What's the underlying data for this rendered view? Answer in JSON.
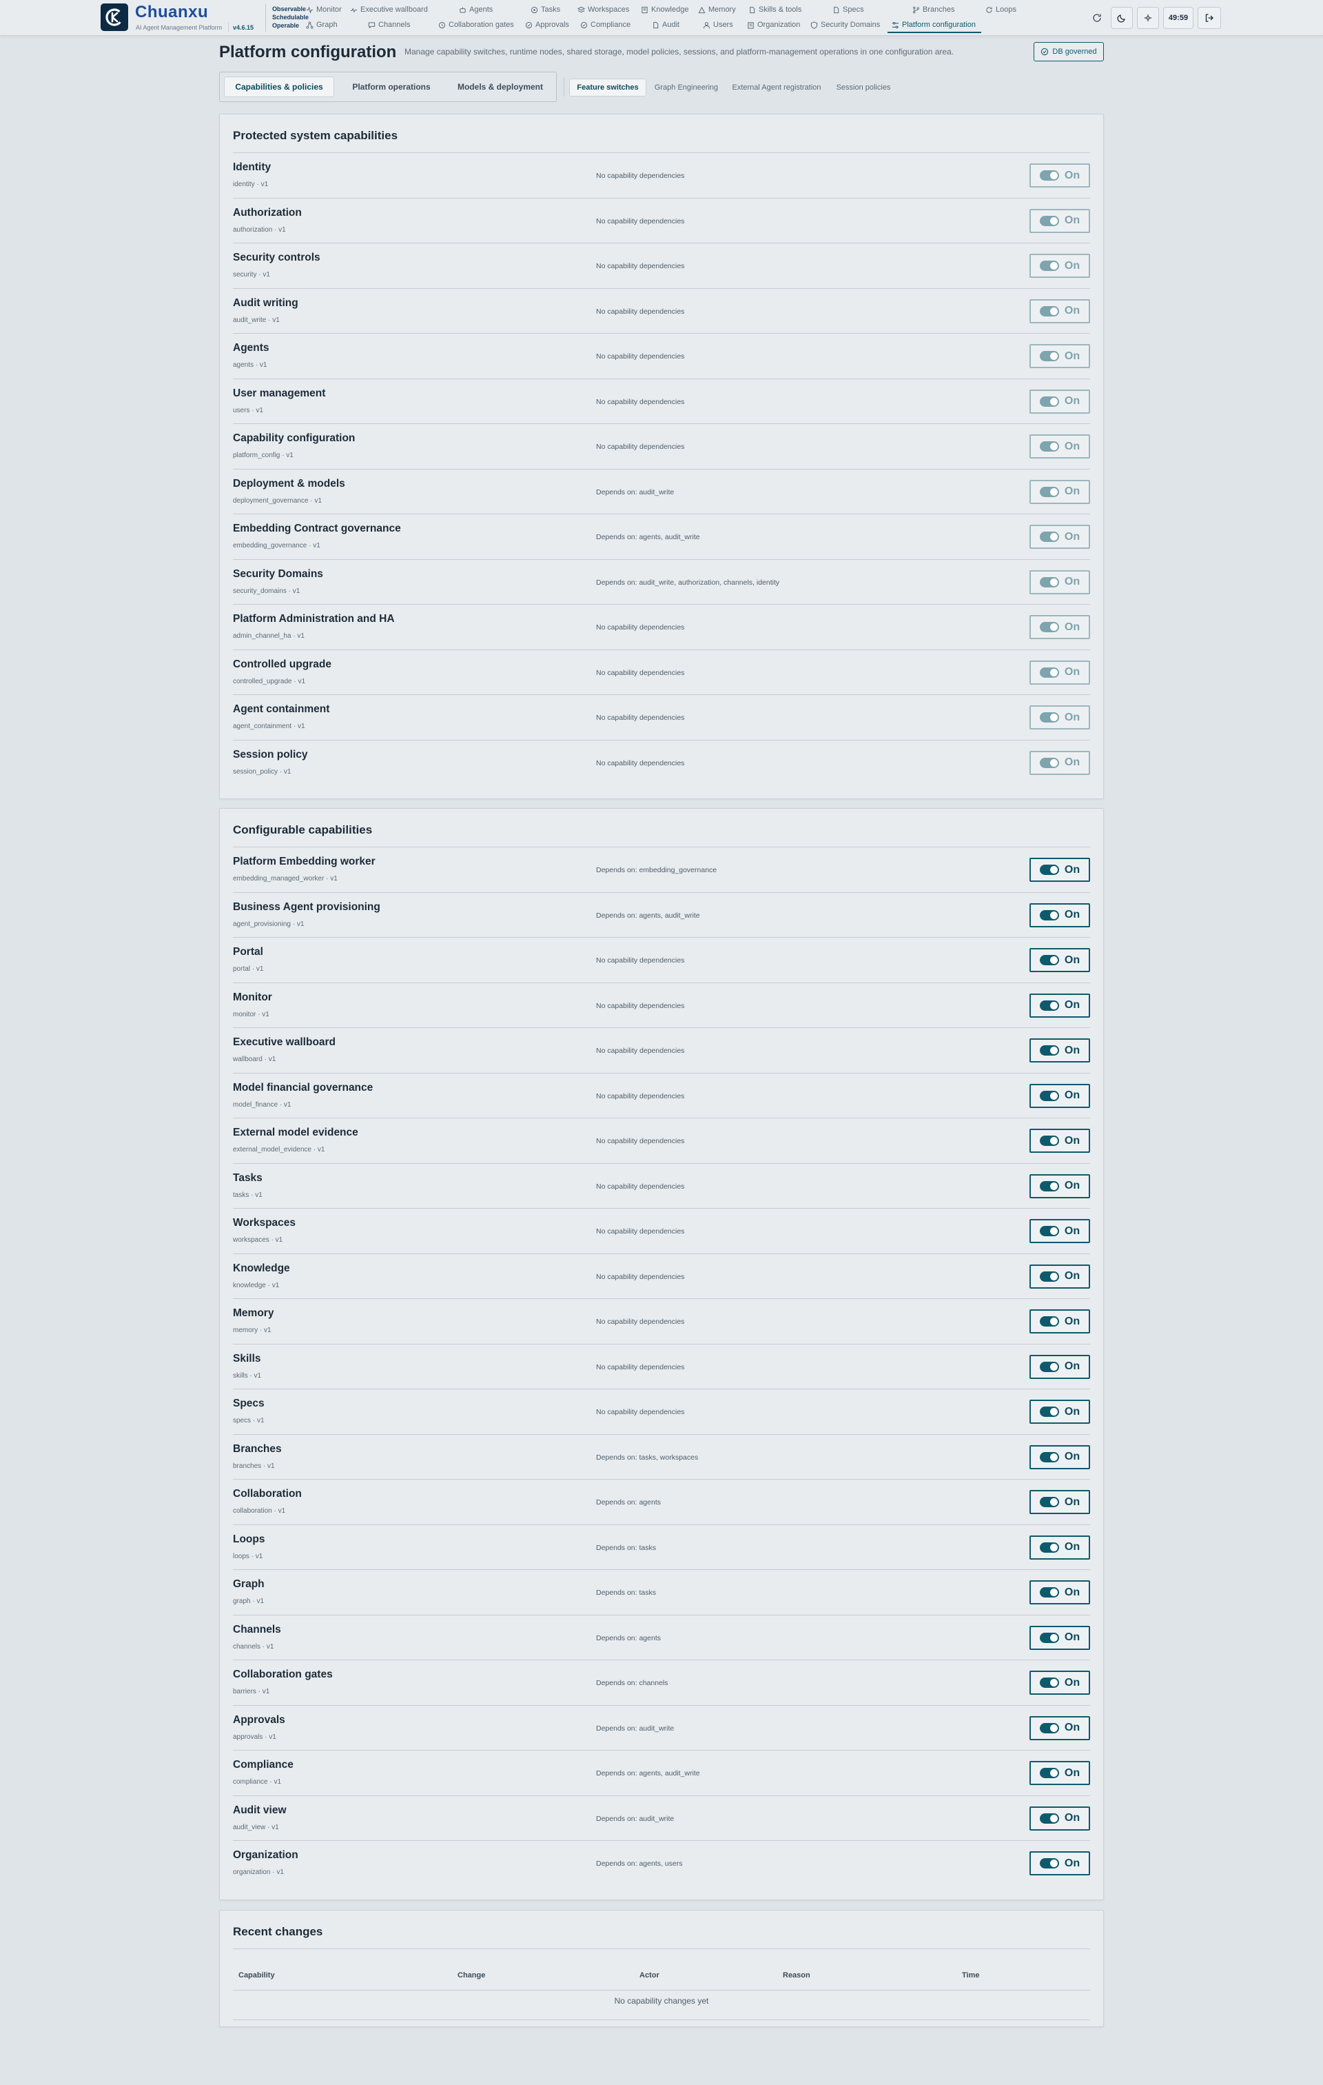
{
  "app": {
    "name": "Chuanxu",
    "subtitle": "AI Agent Management Platform",
    "version": "v4.6.15",
    "tagline": [
      "Observable",
      "Schedulable",
      "Operable"
    ]
  },
  "nav": {
    "row1": [
      "Monitor",
      "Executive wallboard",
      "Agents",
      "Tasks",
      "Workspaces",
      "Knowledge",
      "Memory",
      "Skills & tools",
      "Specs",
      "Branches",
      "Loops"
    ],
    "row2": [
      "Graph",
      "Channels",
      "Collaboration gates",
      "Approvals",
      "Compliance",
      "Audit",
      "Users",
      "Organization",
      "Security Domains",
      "Platform configuration"
    ]
  },
  "header_actions": {
    "timer": "49:59"
  },
  "page": {
    "title": "Platform configuration",
    "description": "Manage capability switches, runtime nodes, shared storage, model policies, sessions, and platform-management operations in one configuration area.",
    "badge": "DB governed"
  },
  "tabs": [
    "Capabilities & policies",
    "Platform operations",
    "Models & deployment"
  ],
  "subtabs": [
    "Feature switches",
    "Graph Engineering",
    "External Agent registration",
    "Session policies"
  ],
  "toggle_label": "On",
  "protected": {
    "title": "Protected system capabilities",
    "items": [
      {
        "name": "Identity",
        "key": "identity · v1",
        "dep": "No capability dependencies"
      },
      {
        "name": "Authorization",
        "key": "authorization · v1",
        "dep": "No capability dependencies"
      },
      {
        "name": "Security controls",
        "key": "security · v1",
        "dep": "No capability dependencies"
      },
      {
        "name": "Audit writing",
        "key": "audit_write · v1",
        "dep": "No capability dependencies"
      },
      {
        "name": "Agents",
        "key": "agents · v1",
        "dep": "No capability dependencies"
      },
      {
        "name": "User management",
        "key": "users · v1",
        "dep": "No capability dependencies"
      },
      {
        "name": "Capability configuration",
        "key": "platform_config · v1",
        "dep": "No capability dependencies"
      },
      {
        "name": "Deployment & models",
        "key": "deployment_governance · v1",
        "dep": "Depends on: audit_write"
      },
      {
        "name": "Embedding Contract governance",
        "key": "embedding_governance · v1",
        "dep": "Depends on: agents, audit_write"
      },
      {
        "name": "Security Domains",
        "key": "security_domains · v1",
        "dep": "Depends on: audit_write, authorization, channels, identity"
      },
      {
        "name": "Platform Administration and HA",
        "key": "admin_channel_ha · v1",
        "dep": "No capability dependencies"
      },
      {
        "name": "Controlled upgrade",
        "key": "controlled_upgrade · v1",
        "dep": "No capability dependencies"
      },
      {
        "name": "Agent containment",
        "key": "agent_containment · v1",
        "dep": "No capability dependencies"
      },
      {
        "name": "Session policy",
        "key": "session_policy · v1",
        "dep": "No capability dependencies"
      }
    ]
  },
  "configurable": {
    "title": "Configurable capabilities",
    "items": [
      {
        "name": "Platform Embedding worker",
        "key": "embedding_managed_worker · v1",
        "dep": "Depends on: embedding_governance"
      },
      {
        "name": "Business Agent provisioning",
        "key": "agent_provisioning · v1",
        "dep": "Depends on: agents, audit_write"
      },
      {
        "name": "Portal",
        "key": "portal · v1",
        "dep": "No capability dependencies"
      },
      {
        "name": "Monitor",
        "key": "monitor · v1",
        "dep": "No capability dependencies"
      },
      {
        "name": "Executive wallboard",
        "key": "wallboard · v1",
        "dep": "No capability dependencies"
      },
      {
        "name": "Model financial governance",
        "key": "model_finance · v1",
        "dep": "No capability dependencies"
      },
      {
        "name": "External model evidence",
        "key": "external_model_evidence · v1",
        "dep": "No capability dependencies"
      },
      {
        "name": "Tasks",
        "key": "tasks · v1",
        "dep": "No capability dependencies"
      },
      {
        "name": "Workspaces",
        "key": "workspaces · v1",
        "dep": "No capability dependencies"
      },
      {
        "name": "Knowledge",
        "key": "knowledge · v1",
        "dep": "No capability dependencies"
      },
      {
        "name": "Memory",
        "key": "memory · v1",
        "dep": "No capability dependencies"
      },
      {
        "name": "Skills",
        "key": "skills · v1",
        "dep": "No capability dependencies"
      },
      {
        "name": "Specs",
        "key": "specs · v1",
        "dep": "No capability dependencies"
      },
      {
        "name": "Branches",
        "key": "branches · v1",
        "dep": "Depends on: tasks, workspaces"
      },
      {
        "name": "Collaboration",
        "key": "collaboration · v1",
        "dep": "Depends on: agents"
      },
      {
        "name": "Loops",
        "key": "loops · v1",
        "dep": "Depends on: tasks"
      },
      {
        "name": "Graph",
        "key": "graph · v1",
        "dep": "Depends on: tasks"
      },
      {
        "name": "Channels",
        "key": "channels · v1",
        "dep": "Depends on: agents"
      },
      {
        "name": "Collaboration gates",
        "key": "barriers · v1",
        "dep": "Depends on: channels"
      },
      {
        "name": "Approvals",
        "key": "approvals · v1",
        "dep": "Depends on: audit_write"
      },
      {
        "name": "Compliance",
        "key": "compliance · v1",
        "dep": "Depends on: agents, audit_write"
      },
      {
        "name": "Audit view",
        "key": "audit_view · v1",
        "dep": "Depends on: audit_write"
      },
      {
        "name": "Organization",
        "key": "organization · v1",
        "dep": "Depends on: agents, users"
      }
    ]
  },
  "recent": {
    "title": "Recent changes",
    "columns": [
      "Capability",
      "Change",
      "Actor",
      "Reason",
      "Time"
    ],
    "empty": "No capability changes yet"
  },
  "colors": {
    "accent": "#0e5a6d",
    "brand": "#1d4e9e",
    "locked": "#7ea4ae"
  }
}
